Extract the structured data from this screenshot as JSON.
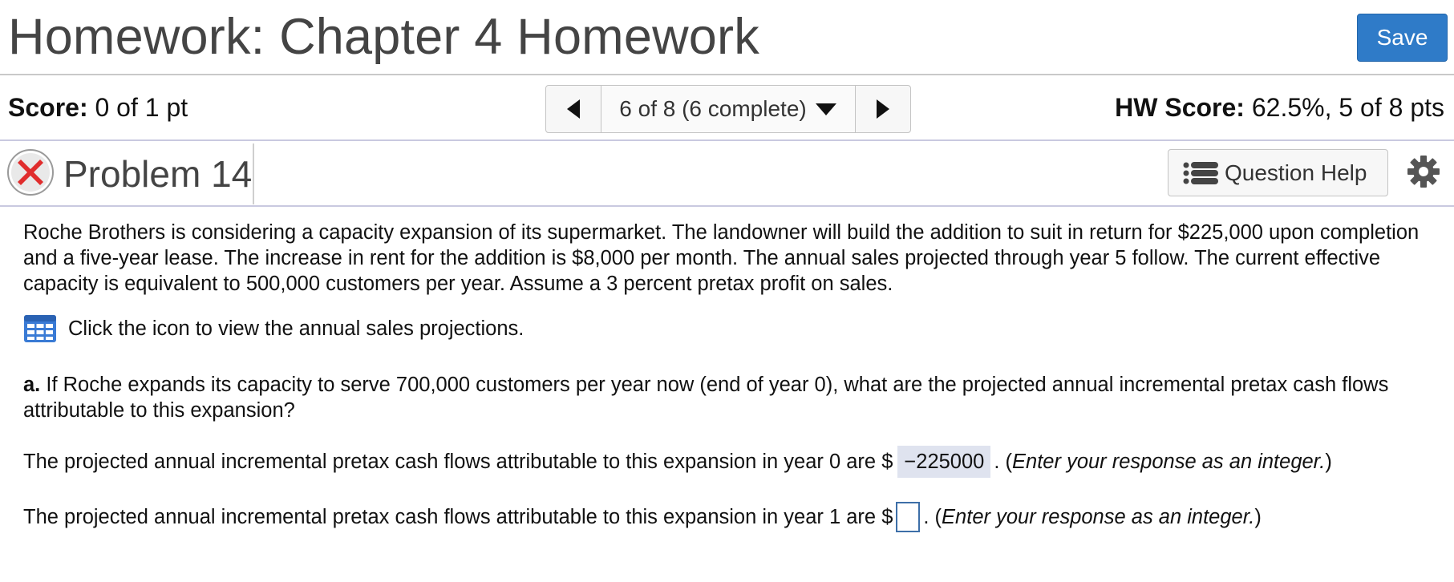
{
  "header": {
    "title": "Homework: Chapter 4 Homework",
    "save_label": "Save"
  },
  "score_bar": {
    "score_label": "Score:",
    "score_value": "0 of 1 pt",
    "nav_position": "6 of 8 (6 complete)",
    "hw_score_label": "HW Score:",
    "hw_score_value": "62.5%, 5 of 8 pts"
  },
  "problem_bar": {
    "problem_label": "Problem 14",
    "status_icon": "red-x-circle-icon",
    "help_label": "Question Help",
    "colors": {
      "save_button": "#2f7bc8",
      "status_red": "#e02d2d",
      "answer_highlight": "#dfe3ef"
    }
  },
  "content": {
    "intro": "Roche Brothers is considering a capacity expansion of its supermarket. The landowner will build the addition to suit in return for $225,000 upon completion and a five-year lease. The increase in rent for the addition is $8,000 per month. The annual sales projected through year 5 follow. The current effective capacity is equivalent to 500,000 customers per year. Assume a 3 percent pretax profit on sales.",
    "sales_link": "Click the icon to view the annual sales projections.",
    "part_a_label": "a.",
    "part_a_question": "If Roche expands its capacity to serve 700,000 customers per year now (end of year 0), what are the projected annual incremental pretax cash flows attributable to this expansion?",
    "year0_prefix": "The projected annual incremental pretax cash flows attributable to this expansion in year 0 are $",
    "year0_value": "−225000",
    "year1_prefix": "The projected annual incremental pretax cash flows attributable to this expansion in year 1 are $",
    "year1_value": "",
    "hint_open": ". (",
    "hint_text": "Enter your response as an integer.",
    "hint_close": ")"
  }
}
